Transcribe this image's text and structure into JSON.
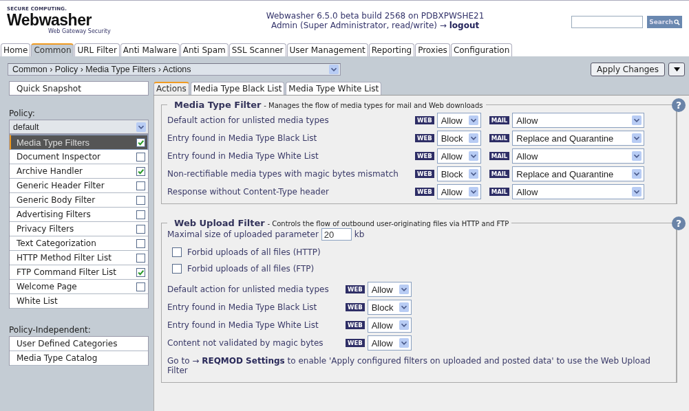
{
  "header": {
    "company": "SECURE COMPUTING.",
    "brand": "Webwasher",
    "tagline": "Web Gateway Security",
    "title": "Webwasher 6.5.0 beta build 2568 on PDBXPWSHE21",
    "user": "Admin (Super Administrator, read/write) →",
    "logout": "logout",
    "search_button": "Search"
  },
  "main_tabs": [
    {
      "label": "Home",
      "selected": false
    },
    {
      "label": "Common",
      "selected": true
    },
    {
      "label": "URL Filter",
      "selected": false
    },
    {
      "label": "Anti Malware",
      "selected": false
    },
    {
      "label": "Anti Spam",
      "selected": false
    },
    {
      "label": "SSL Scanner",
      "selected": false
    },
    {
      "label": "User Management",
      "selected": false
    },
    {
      "label": "Reporting",
      "selected": false
    },
    {
      "label": "Proxies",
      "selected": false
    },
    {
      "label": "Configuration",
      "selected": false
    }
  ],
  "breadcrumb": "Common › Policy › Media Type Filters › Actions",
  "apply_button": "Apply Changes",
  "sidebar": {
    "quick_snapshot": "Quick Snapshot",
    "policy_label": "Policy:",
    "policy": "default",
    "filters": [
      {
        "label": "Media Type Filters",
        "kind": "checkbox",
        "selected": true,
        "checked": true
      },
      {
        "label": "Document Inspector",
        "kind": "checkbox",
        "selected": false,
        "checked": false
      },
      {
        "label": "Archive Handler",
        "kind": "checkbox",
        "selected": false,
        "checked": true
      },
      {
        "label": "Generic Header Filter",
        "kind": "checkbox",
        "selected": false,
        "checked": false
      },
      {
        "label": "Generic Body Filter",
        "kind": "checkbox",
        "selected": false,
        "checked": false
      },
      {
        "label": "Advertising Filters",
        "kind": "checkbox",
        "selected": false,
        "checked": false
      },
      {
        "label": "Privacy Filters",
        "kind": "checkbox",
        "selected": false,
        "checked": false
      },
      {
        "label": "Text Categorization",
        "kind": "checkbox",
        "selected": false,
        "checked": false
      },
      {
        "label": "HTTP Method Filter List",
        "kind": "checkbox",
        "selected": false,
        "checked": false
      },
      {
        "label": "FTP Command Filter List",
        "kind": "checkbox",
        "selected": false,
        "checked": true
      },
      {
        "label": "Welcome Page",
        "kind": "checkbox",
        "selected": false,
        "checked": false
      },
      {
        "label": "White List",
        "kind": "plain",
        "selected": false
      }
    ],
    "independent_label": "Policy-Independent:",
    "independent_items": [
      "User Defined Categories",
      "Media Type Catalog"
    ]
  },
  "sub_tabs": [
    {
      "label": "Actions",
      "selected": true
    },
    {
      "label": "Media Type Black List",
      "selected": false
    },
    {
      "label": "Media Type White List",
      "selected": false
    }
  ],
  "media_type_filter": {
    "title": "Media Type Filter",
    "description": "- Manages the flow of media types for mail and Web downloads",
    "help": "?",
    "rows": [
      {
        "label": "Default action for unlisted media types",
        "web_tag": "WEB",
        "web": "Allow",
        "mail_tag": "MAIL",
        "mail": "Allow"
      },
      {
        "label": "Entry found in Media Type Black List",
        "web_tag": "WEB",
        "web": "Block",
        "mail_tag": "MAIL",
        "mail": "Replace and Quarantine"
      },
      {
        "label": "Entry found in Media Type White List",
        "web_tag": "WEB",
        "web": "Allow",
        "mail_tag": "MAIL",
        "mail": "Allow"
      },
      {
        "label": "Non-rectifiable media types with magic bytes mismatch",
        "web_tag": "WEB",
        "web": "Block",
        "mail_tag": "MAIL",
        "mail": "Replace and Quarantine"
      },
      {
        "label": "Response without Content-Type header",
        "web_tag": "WEB",
        "web": "Allow",
        "mail_tag": "MAIL",
        "mail": "Allow"
      }
    ]
  },
  "web_upload_filter": {
    "title": "Web Upload Filter",
    "description": "- Controls the flow of outbound user-originating files via HTTP and FTP",
    "help": "?",
    "max_size": {
      "label": "Maximal size of uploaded parameter",
      "value": "20",
      "unit": "kb"
    },
    "options": [
      {
        "label": "Forbid uploads of all files (HTTP)",
        "checked": false
      },
      {
        "label": "Forbid uploads of all files (FTP)",
        "checked": false
      }
    ],
    "rows": [
      {
        "label": "Default action for unlisted media types",
        "web_tag": "WEB",
        "web": "Allow"
      },
      {
        "label": "Entry found in Media Type Black List",
        "web_tag": "WEB",
        "web": "Block"
      },
      {
        "label": "Entry found in Media Type White List",
        "web_tag": "WEB",
        "web": "Allow"
      },
      {
        "label": "Content not validated by magic bytes",
        "web_tag": "WEB",
        "web": "Allow"
      }
    ],
    "note": {
      "prefix": "Go to →",
      "link": "REQMOD Settings",
      "suffix": "to enable 'Apply configured filters on uploaded and posted data' to use the Web Upload Filter"
    }
  }
}
